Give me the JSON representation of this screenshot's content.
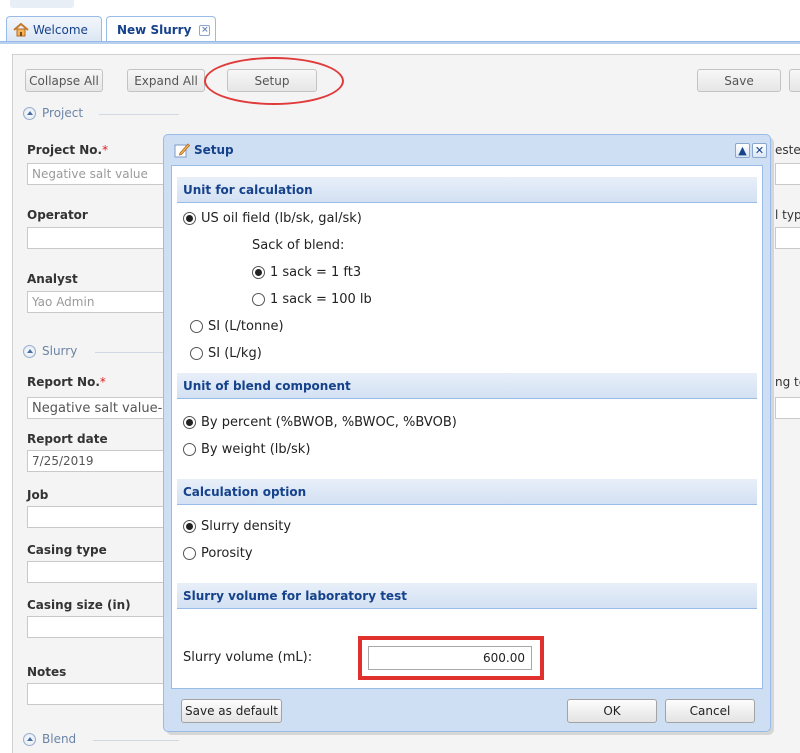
{
  "tabs": {
    "welcome": "Welcome",
    "new_slurry": "New Slurry"
  },
  "toolbar": {
    "collapse_all": "Collapse All",
    "expand_all": "Expand All",
    "setup": "Setup",
    "save": "Save"
  },
  "form": {
    "project_section": "Project",
    "project_no_label": "Project No.",
    "project_no_value": "Negative salt value",
    "operator_label": "Operator",
    "analyst_label": "Analyst",
    "analyst_value": "Yao Admin",
    "slurry_section": "Slurry",
    "report_no_label": "Report No.",
    "report_no_value": "Negative salt value-(",
    "report_date_label": "Report date",
    "report_date_value": "7/25/2019",
    "job_label": "Job",
    "casing_type_label": "Casing type",
    "casing_size_label": "Casing size (in)",
    "notes_label": "Notes",
    "blend_section": "Blend",
    "right_cut_1": "este",
    "right_cut_2": "l typ",
    "right_cut_3": "ng te",
    "required_mark": "*"
  },
  "dialog": {
    "title": "Setup",
    "unit_calc": {
      "header": "Unit for calculation",
      "us_oil": "US oil field (lb/sk, gal/sk)",
      "sack_of_blend": "Sack of blend:",
      "sack_ft3": "1 sack = 1 ft3",
      "sack_lb": "1 sack = 100 lb",
      "si_tonne": "SI (L/tonne)",
      "si_kg": "SI (L/kg)"
    },
    "unit_blend": {
      "header": "Unit of blend component",
      "by_percent": "By percent (%BWOB, %BWOC, %BVOB)",
      "by_weight": "By weight (lb/sk)"
    },
    "calc_option": {
      "header": "Calculation option",
      "density": "Slurry density",
      "porosity": "Porosity"
    },
    "slurry_volume": {
      "header": "Slurry volume for laboratory test",
      "label": "Slurry volume (mL):",
      "value": "600.00"
    },
    "buttons": {
      "save_default": "Save as default",
      "ok": "OK",
      "cancel": "Cancel"
    }
  },
  "colors": {
    "highlight_red": "#e0312f",
    "header_blue": "#15428b"
  }
}
